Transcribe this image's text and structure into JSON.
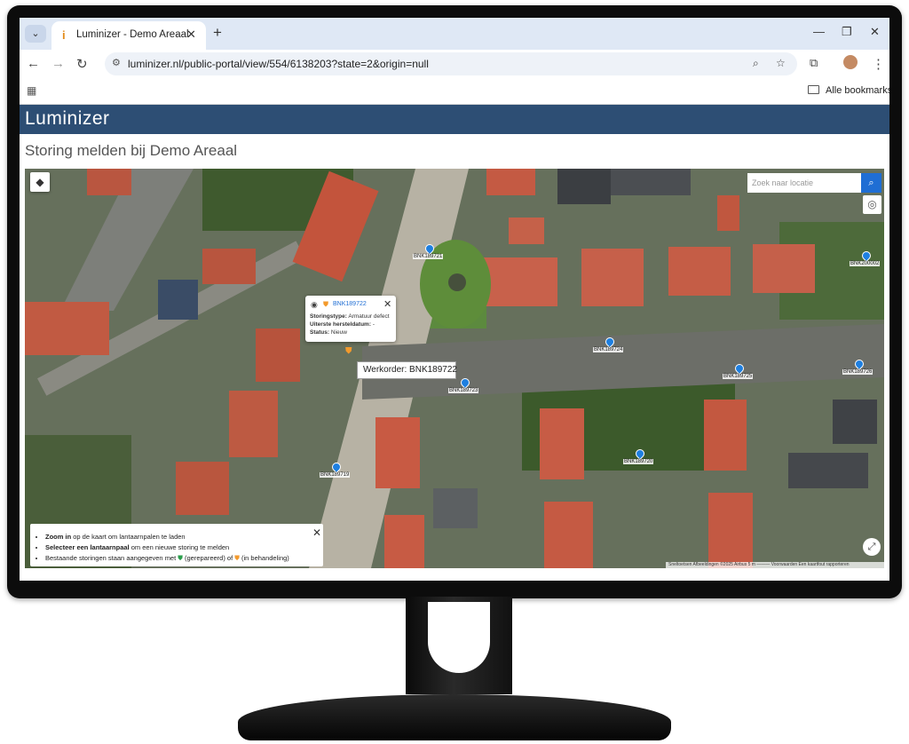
{
  "browser": {
    "tab_title": "Luminizer - Demo Areaal",
    "url": "luminizer.nl/public-portal/view/554/6138203?state=2&origin=null",
    "bookmarks_label": "Alle bookmarks"
  },
  "app": {
    "logo": "Luminizer",
    "page_title": "Storing melden bij Demo Areaal"
  },
  "map": {
    "search_placeholder": "Zoek naar locatie",
    "popup": {
      "code": "BNK189722",
      "storingstype_label": "Storingstype:",
      "storingstype_value": "Armatuur defect",
      "hersteldatum_label": "Uiterste hersteldatum:",
      "hersteldatum_value": "-",
      "status_label": "Status:",
      "status_value": "Nieuw"
    },
    "tooltip": "Werkorder: BNK189722",
    "pins": [
      {
        "label": "BNK189721"
      },
      {
        "label": "BNK189724"
      },
      {
        "label": "BNK189723"
      },
      {
        "label": "BNK189725"
      },
      {
        "label": "BNK189726"
      },
      {
        "label": "BNK189720"
      },
      {
        "label": "BNK189719"
      },
      {
        "label": "BNK200002"
      }
    ],
    "info": {
      "line1_bold": "Zoom in",
      "line1_rest": " op de kaart om lantaarnpalen te laden",
      "line2_bold": "Selecteer een lantaarnpaal",
      "line2_rest": " om een nieuwe storing te melden",
      "line3_a": "Bestaande storingen staan aangegeven met ",
      "line3_b": " (gerepareerd) of ",
      "line3_c": " (in behandeling)"
    },
    "attribution": "Sneltoetsen   Afbeeldingen ©2025 Airbus   5 m ———   Voorwaarden   Een kaartfout rapporteren"
  },
  "colors": {
    "app_header": "#2d4e74",
    "pin": "#1e7fe0",
    "search_button": "#1f6ed4",
    "in_progress": "#f39a2c",
    "repaired": "#2a9d4b"
  }
}
